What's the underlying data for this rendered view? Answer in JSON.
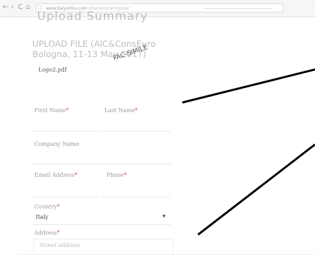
{
  "browser": {
    "back_icon": "←",
    "forward_icon": "›",
    "reload_icon": "C",
    "home_icon": "⌂",
    "url_icon": "ⓘ",
    "url": "www.italyuhlov.com",
    "url_path": "/checkout/#register"
  },
  "page": {
    "section_title_cut": "Upload Summary",
    "upload_title_line1": "UPLOAD FILE (AIC&ConsEuro",
    "upload_title_line2": "Bologna, 11-13 May 2017)",
    "stamp": "FAC-SIMILE",
    "file_name": "Logo2.pdf"
  },
  "form": {
    "required_mark": "*",
    "first_name_label": "First Name",
    "last_name_label": "Last Name",
    "company_label": "Company Name",
    "email_label": "Email Address",
    "phone_label": "Phone",
    "country_label": "Country",
    "country_value": "Italy",
    "address_label": "Address",
    "address_placeholder": "Street address"
  },
  "colors": {
    "required": "#e33333",
    "annotation_lines": "#000000"
  }
}
